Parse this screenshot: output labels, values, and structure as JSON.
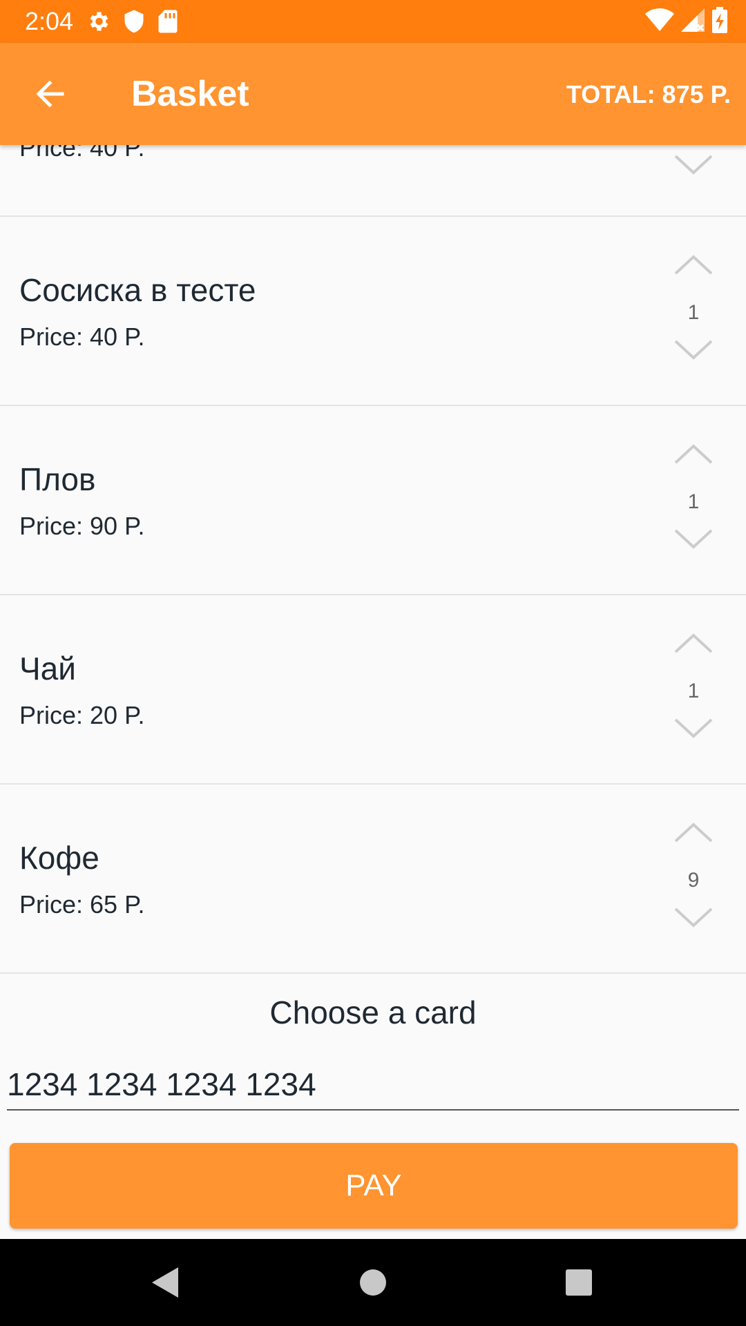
{
  "status_bar": {
    "time": "2:04",
    "icons": [
      "settings-icon",
      "shield-icon",
      "sd-card-icon",
      "wifi-icon",
      "signal-icon",
      "battery-charging-icon"
    ]
  },
  "app_bar": {
    "back_icon": "arrow-left-icon",
    "title": "Basket",
    "total": "TOTAL: 875 P."
  },
  "items": [
    {
      "name": "",
      "price": "Price: 40 P.",
      "qty": ""
    },
    {
      "name": "Сосиска в тесте",
      "price": "Price: 40 P.",
      "qty": "1"
    },
    {
      "name": "Плов",
      "price": "Price: 90 P.",
      "qty": "1"
    },
    {
      "name": "Чай",
      "price": "Price: 20 P.",
      "qty": "1"
    },
    {
      "name": "Кофе",
      "price": "Price: 65 P.",
      "qty": "9"
    }
  ],
  "card": {
    "title": "Choose a card",
    "number": "1234 1234 1234 1234"
  },
  "pay_button": "PAY",
  "colors": {
    "status_bar": "#ff7e0e",
    "app_bar": "#ff9430",
    "pay_button": "#ff9430"
  }
}
